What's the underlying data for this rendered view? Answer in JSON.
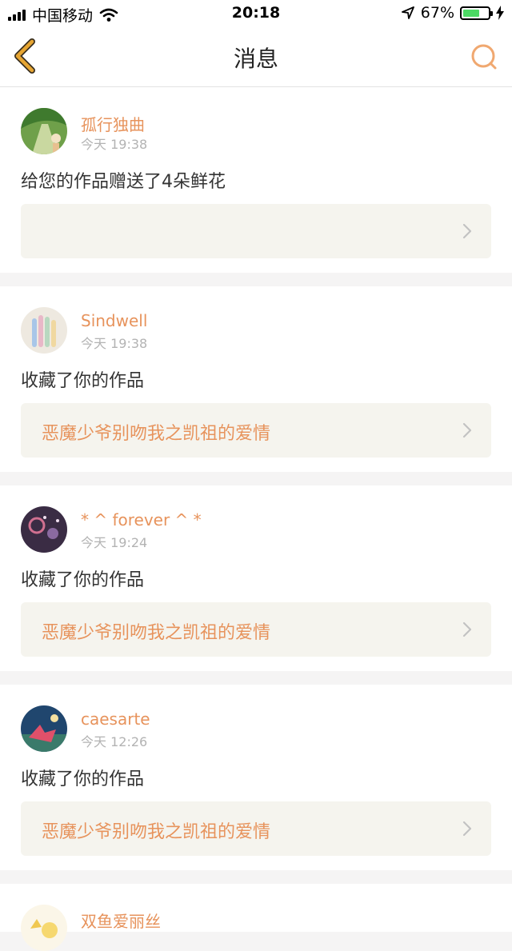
{
  "status_bar": {
    "carrier": "中国移动",
    "time": "20:18",
    "battery_percent_text": "67%",
    "battery_level": 0.67
  },
  "nav": {
    "title": "消息",
    "back_icon": "chevron-left-icon",
    "search_icon": "search-icon"
  },
  "messages": [
    {
      "username": "孤行独曲",
      "time": "今天 19:38",
      "text": "给您的作品赠送了4朵鲜花",
      "work_title": ""
    },
    {
      "username": "Sindwell",
      "time": "今天 19:38",
      "text": "收藏了你的作品",
      "work_title": "恶魔少爷别吻我之凯祖的爱情"
    },
    {
      "username": "* ^ forever ^ *",
      "time": "今天 19:24",
      "text": "收藏了你的作品",
      "work_title": "恶魔少爷别吻我之凯祖的爱情"
    },
    {
      "username": "caesarte",
      "time": "今天 12:26",
      "text": "收藏了你的作品",
      "work_title": "恶魔少爷别吻我之凯祖的爱情"
    },
    {
      "username": "双鱼爱丽丝",
      "time": "",
      "text": "",
      "work_title": ""
    }
  ],
  "colors": {
    "accent": "#e7935c",
    "back_icon": "#e6a532",
    "link_background": "#f5f4ee",
    "page_background": "#f5f4f4"
  }
}
